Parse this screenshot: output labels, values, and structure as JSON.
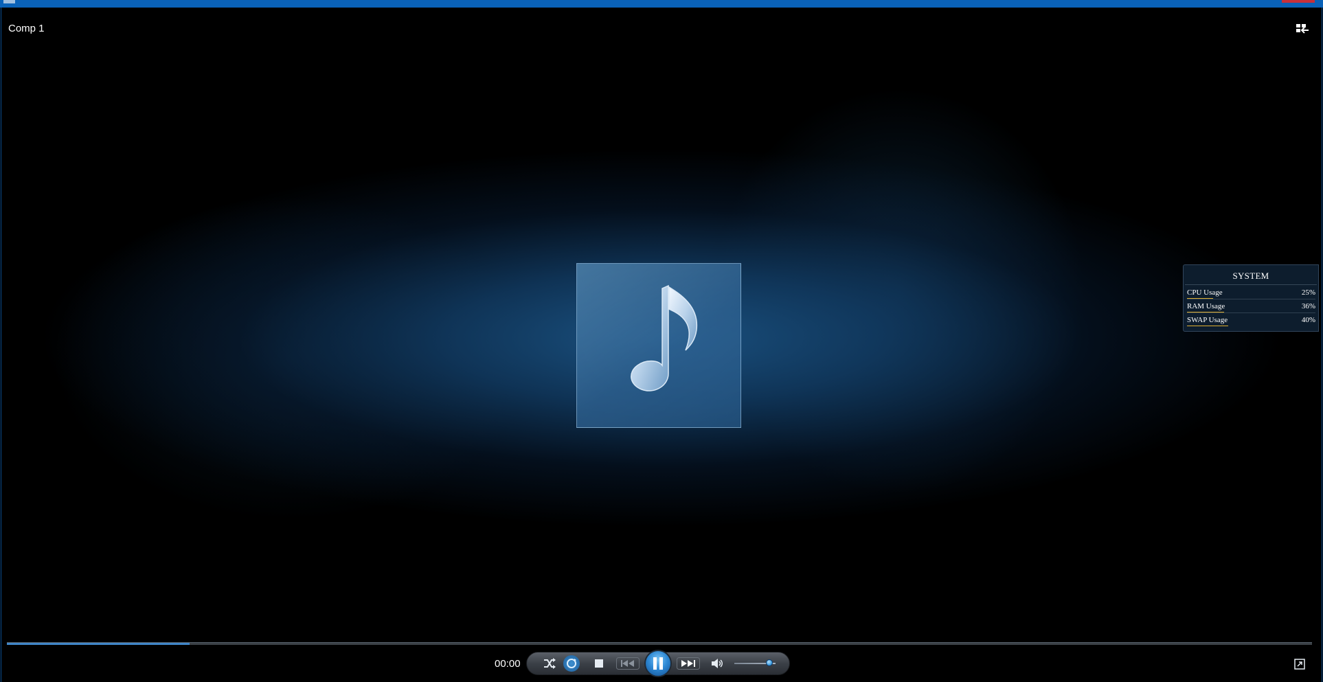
{
  "window": {
    "title": "Comp 1"
  },
  "player": {
    "elapsed_time": "00:00",
    "seek_progress": 0.14,
    "volume_level": 0.85,
    "icons": {
      "layout": "switch-layout-icon",
      "album_art": "music-note-icon",
      "shuffle": "shuffle-icon",
      "repeat": "repeat-icon",
      "stop": "stop-icon",
      "previous": "previous-icon",
      "play_pause": "pause-icon",
      "next": "next-icon",
      "mute": "speaker-icon",
      "fullscreen": "fullscreen-icon"
    }
  },
  "system_panel": {
    "title": "SYSTEM",
    "rows": [
      {
        "label": "CPU Usage",
        "value": "25%",
        "level": 0.25
      },
      {
        "label": "RAM Usage",
        "value": "36%",
        "level": 0.36
      },
      {
        "label": "SWAP Usage",
        "value": "40%",
        "level": 0.4
      }
    ]
  },
  "colors": {
    "title_bar": "#0a62b8",
    "accent": "#3f86c8",
    "usage_bar": "#e0b030"
  }
}
